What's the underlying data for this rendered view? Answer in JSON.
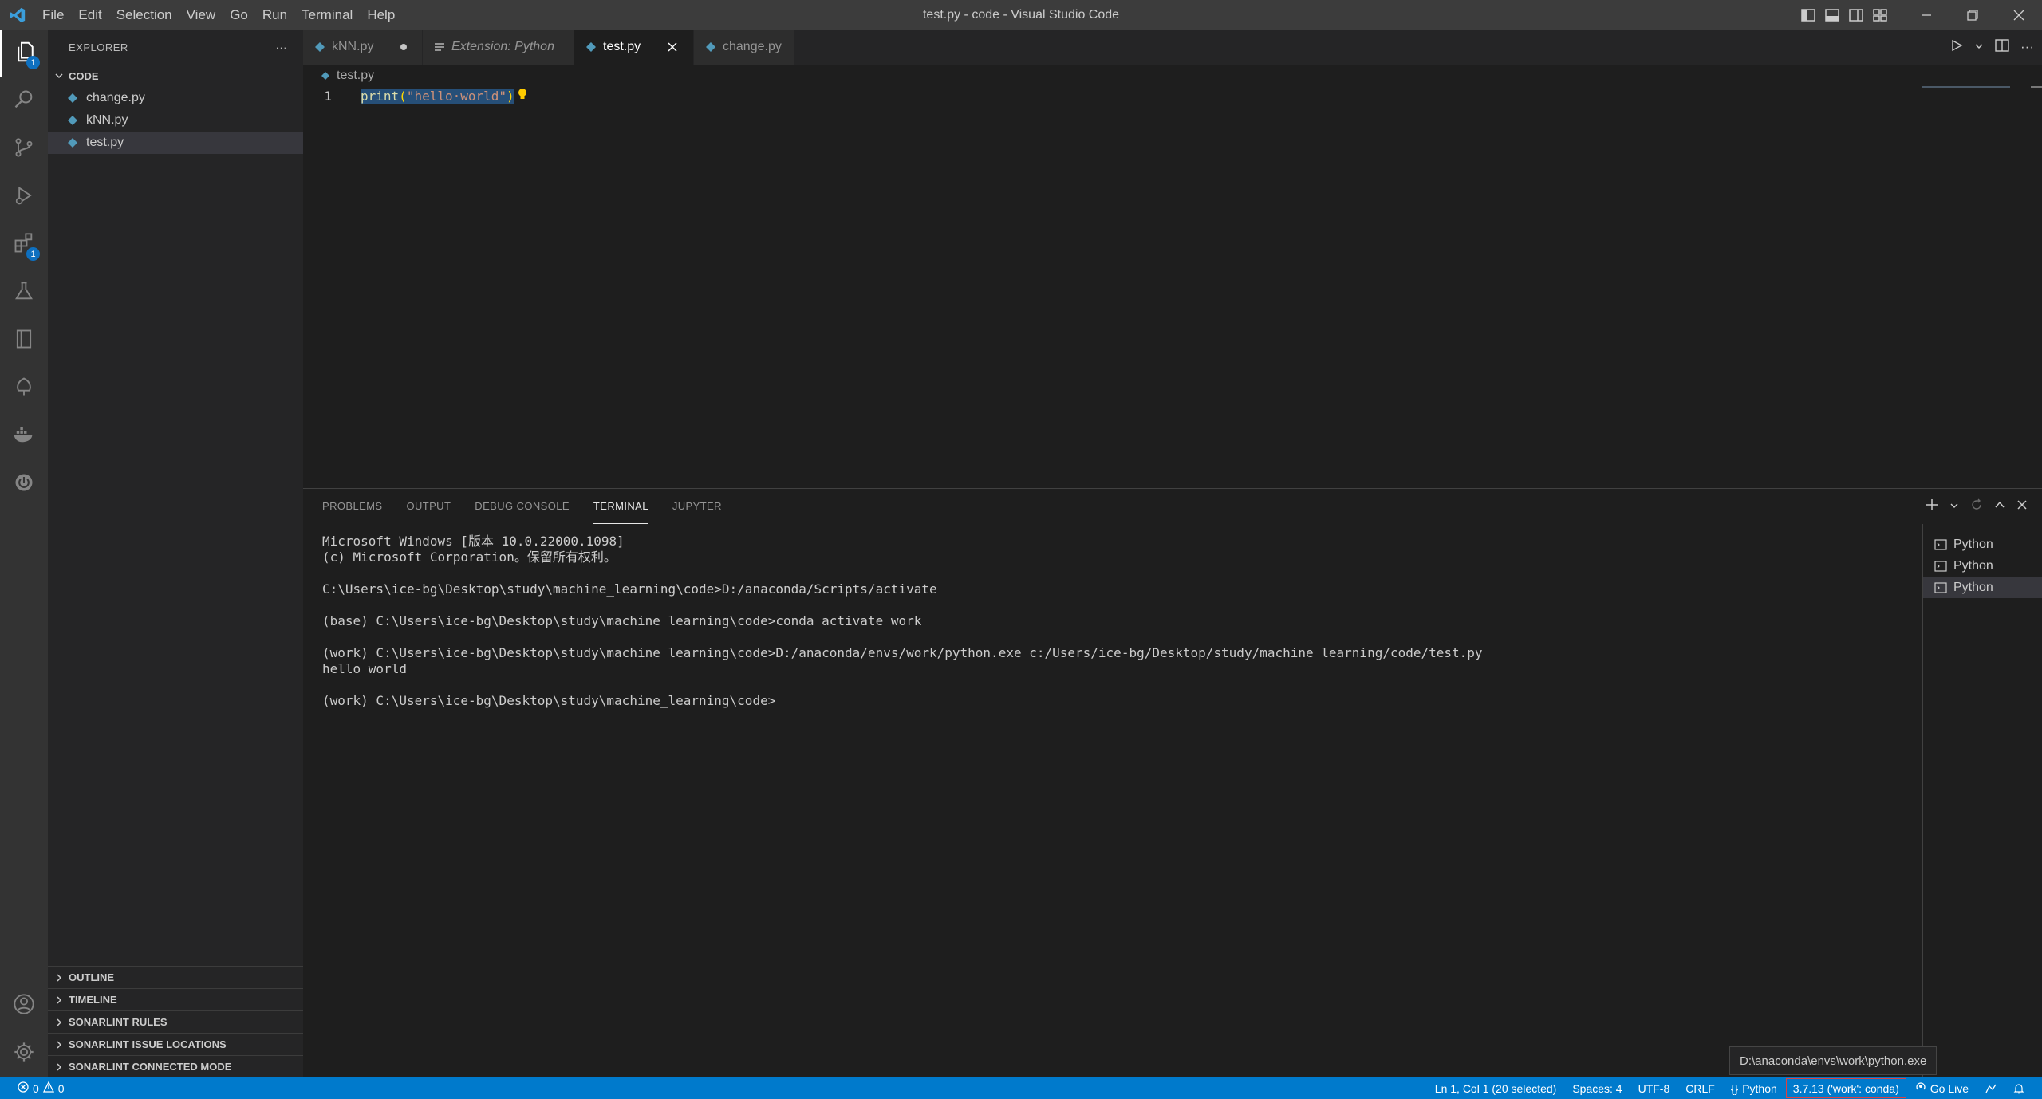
{
  "window": {
    "title": "test.py - code - Visual Studio Code",
    "menu": [
      "File",
      "Edit",
      "Selection",
      "View",
      "Go",
      "Run",
      "Terminal",
      "Help"
    ]
  },
  "activity": {
    "explorer_badge": "1",
    "extensions_badge": "1"
  },
  "sidebar": {
    "header": "EXPLORER",
    "folder": "CODE",
    "files": [
      "change.py",
      "kNN.py",
      "test.py"
    ],
    "bottom_sections": [
      "OUTLINE",
      "TIMELINE",
      "SONARLINT RULES",
      "SONARLINT ISSUE LOCATIONS",
      "SONARLINT CONNECTED MODE"
    ]
  },
  "tabs": {
    "items": [
      "kNN.py",
      "Extension: Python",
      "test.py",
      "change.py"
    ]
  },
  "editor": {
    "breadcrumb": "test.py",
    "line_number": "1",
    "code_fn": "print",
    "code_open": "(",
    "code_str": "\"hello·world\"",
    "code_close": ")"
  },
  "panel": {
    "tabs": [
      "PROBLEMS",
      "OUTPUT",
      "DEBUG CONSOLE",
      "TERMINAL",
      "JUPYTER"
    ],
    "terminal_text": "Microsoft Windows [版本 10.0.22000.1098]\n(c) Microsoft Corporation。保留所有权利。\n\nC:\\Users\\ice-bg\\Desktop\\study\\machine_learning\\code>D:/anaconda/Scripts/activate\n\n(base) C:\\Users\\ice-bg\\Desktop\\study\\machine_learning\\code>conda activate work\n\n(work) C:\\Users\\ice-bg\\Desktop\\study\\machine_learning\\code>D:/anaconda/envs/work/python.exe c:/Users/ice-bg/Desktop/study/machine_learning/code/test.py\nhello world\n\n(work) C:\\Users\\ice-bg\\Desktop\\study\\machine_learning\\code>",
    "terminals": [
      "Python",
      "Python",
      "Python"
    ]
  },
  "tooltip": "D:\\anaconda\\envs\\work\\python.exe",
  "status": {
    "errors": "0",
    "warnings": "0",
    "position": "Ln 1, Col 1 (20 selected)",
    "spaces": "Spaces: 4",
    "encoding": "UTF-8",
    "eol": "CRLF",
    "language": "Python",
    "interpreter": "3.7.13 ('work': conda)",
    "golive": "Go Live"
  },
  "colors": {
    "accent": "#007acc",
    "activity_bar": "#333333",
    "sidebar": "#252526",
    "editor_bg": "#1e1e1e"
  }
}
